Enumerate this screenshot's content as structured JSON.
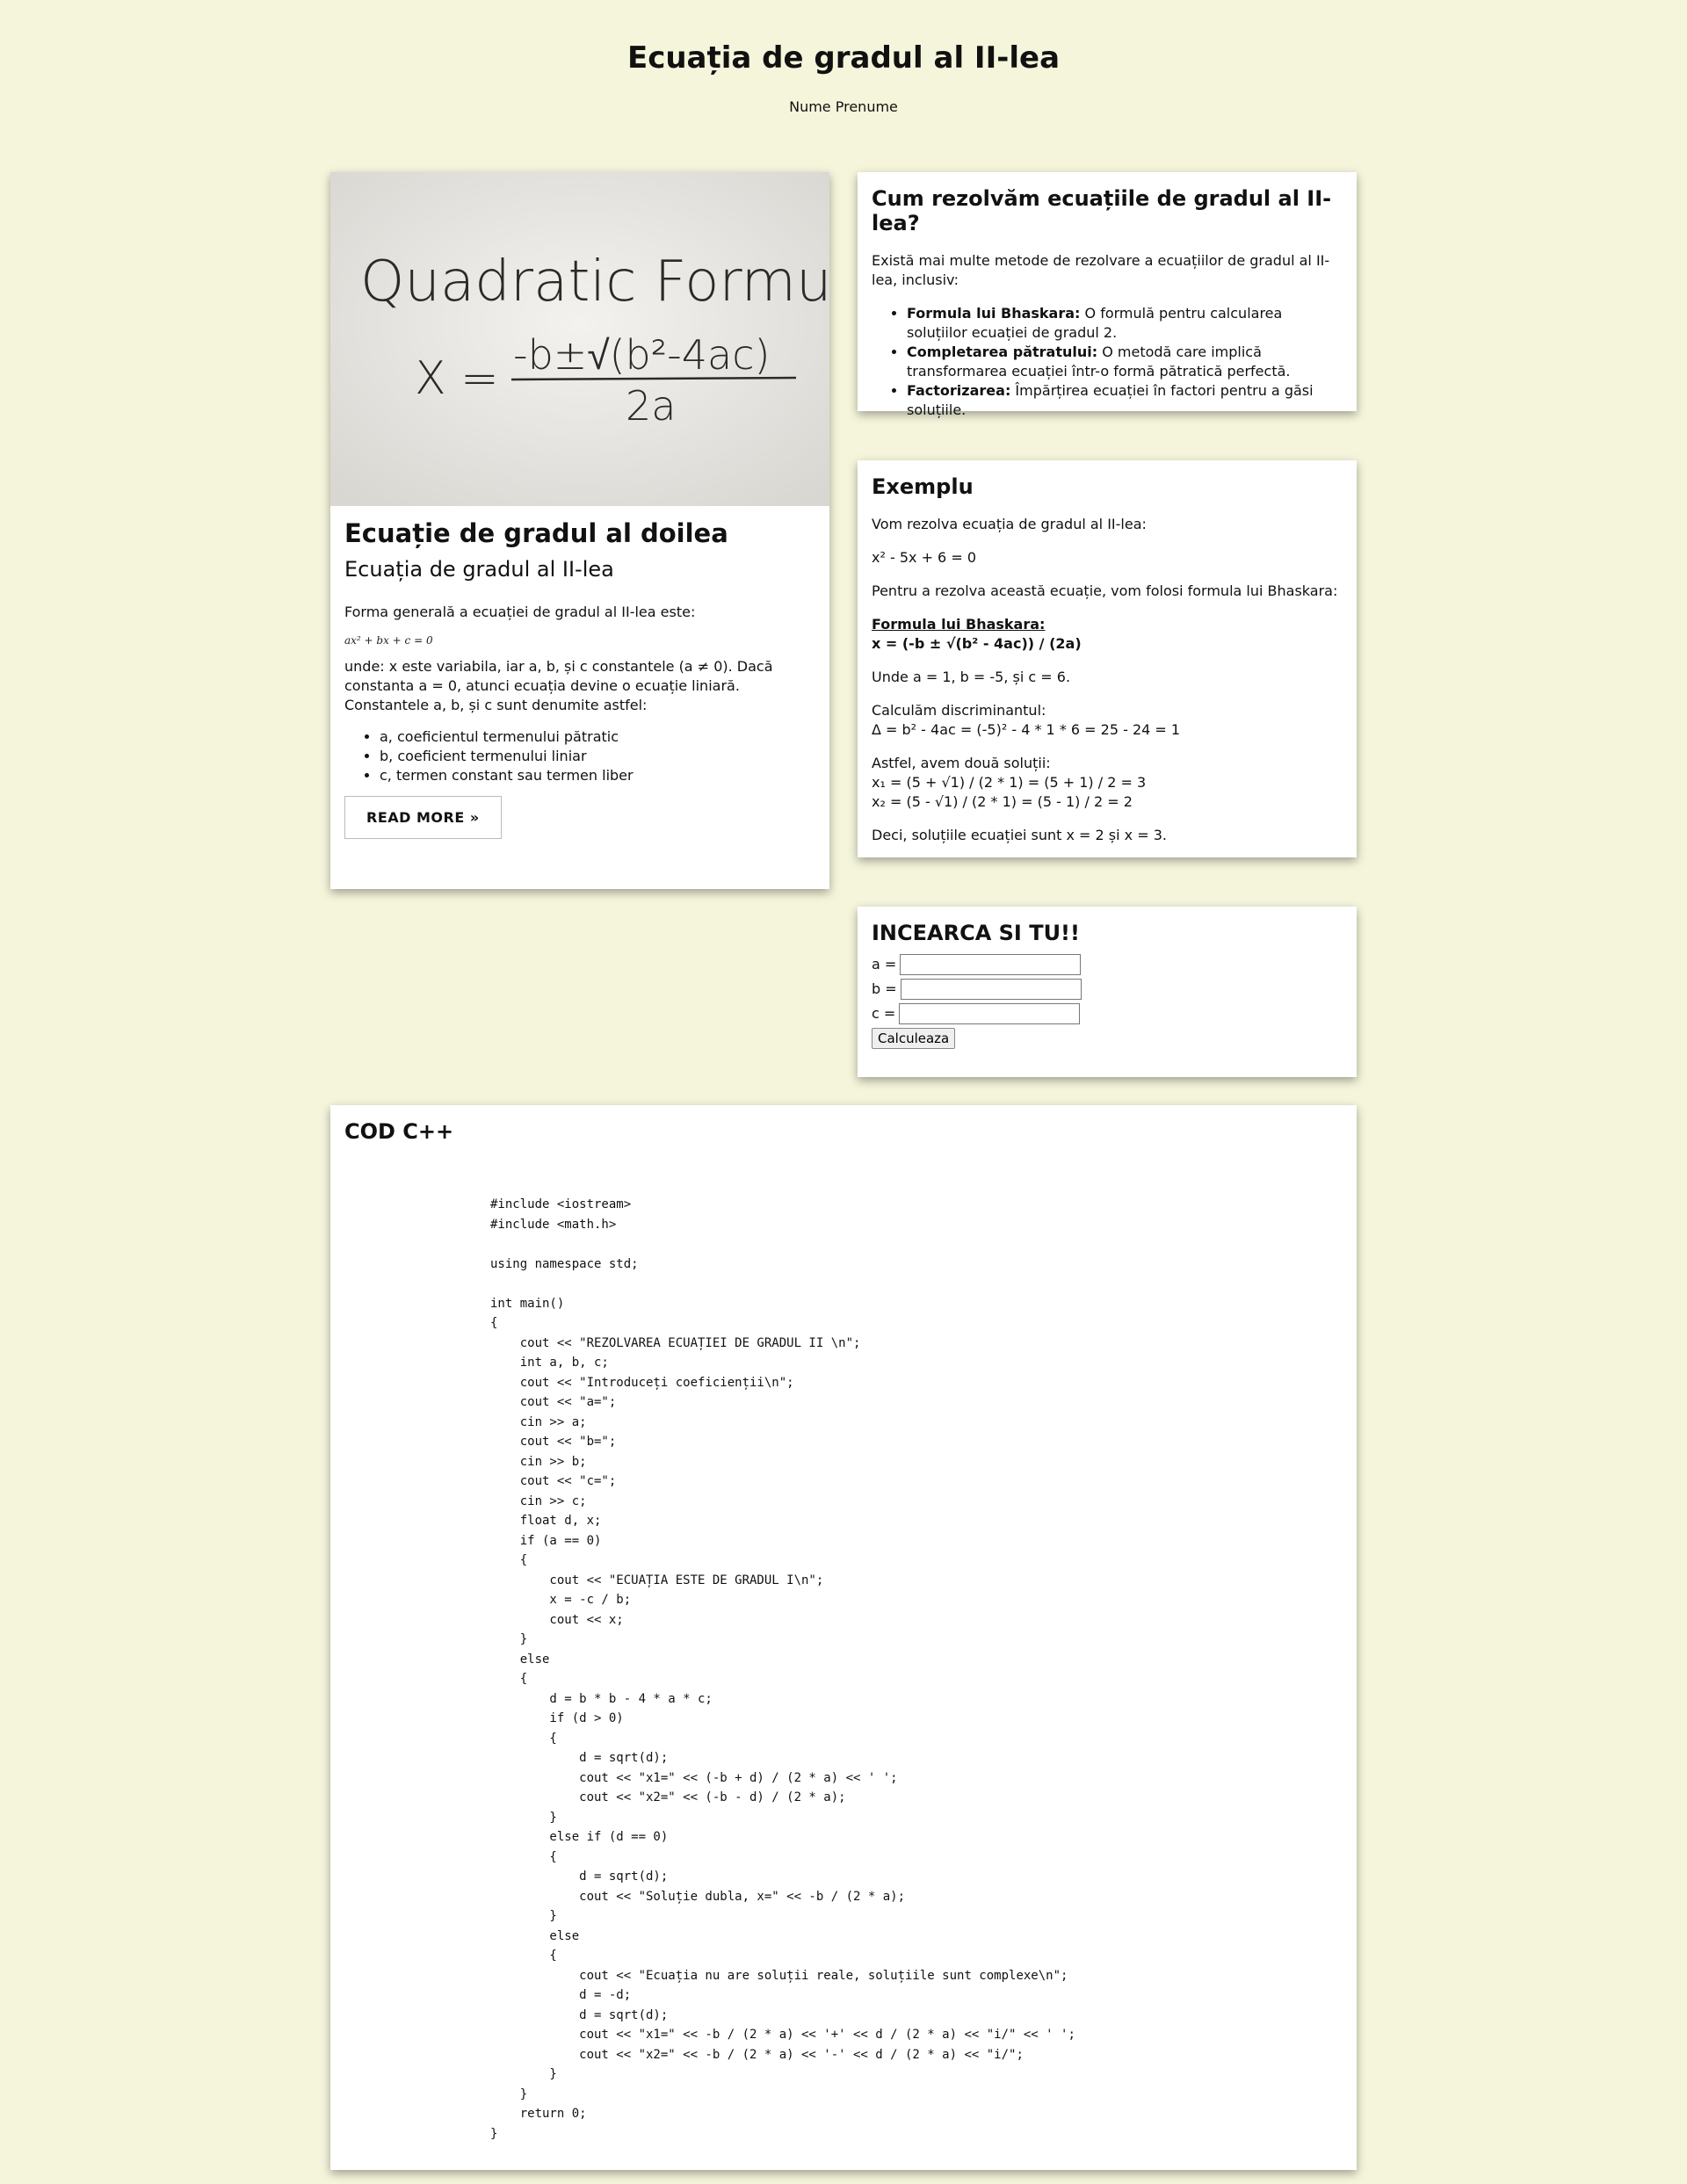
{
  "header": {
    "title": "Ecuația de gradul al II-lea",
    "author": "Nume Prenume"
  },
  "article": {
    "image_text": {
      "line1": "Quadratic Formula",
      "lhs": "X =",
      "numerator": "-b±√(b²-4ac)",
      "denominator": "2a"
    },
    "heading": "Ecuație de gradul al doilea",
    "subheading": "Ecuația de gradul al II-lea",
    "intro": "Forma generală a ecuației de gradul al II-lea este:",
    "formula": "ax² + bx + c = 0",
    "explanation": "unde: x este variabila, iar a, b, și c constantele (a ≠ 0). Dacă constanta a = 0, atunci ecuația devine o ecuație liniară. Constantele a, b, și c sunt denumite astfel:",
    "list": [
      "a, coeficientul termenului pătratic",
      "b, coeficient termenului liniar",
      "c, termen constant sau termen liber"
    ],
    "read_more": "READ MORE »"
  },
  "methods": {
    "title": "Cum rezolvăm ecuațiile de gradul al II-lea?",
    "intro": "Există mai multe metode de rezolvare a ecuațiilor de gradul al II-lea, inclusiv:",
    "items": [
      {
        "term": "Formula lui Bhaskara:",
        "desc": " O formulă pentru calcularea soluțiilor ecuației de gradul 2."
      },
      {
        "term": "Completarea pătratului:",
        "desc": " O metodă care implică transformarea ecuației într-o formă pătratică perfectă."
      },
      {
        "term": "Factorizarea:",
        "desc": " Împărțirea ecuației în factori pentru a găsi soluțiile."
      }
    ]
  },
  "example": {
    "title": "Exemplu",
    "line1": "Vom rezolva ecuația de gradul al II-lea:",
    "equation": "x² - 5x + 6 = 0",
    "line2": "Pentru a rezolva această ecuație, vom folosi formula lui Bhaskara:",
    "formula_label": "Formula lui Bhaskara:",
    "formula": "x = (-b ± √(b² - 4ac)) / (2a)",
    "coefs": "Unde a = 1, b = -5, și c = 6.",
    "disc_label": "Calculăm discriminantul:",
    "disc": "Δ = b² - 4ac = (-5)² - 4 * 1 * 6 = 25 - 24 = 1",
    "sol_label": "Astfel, avem două soluții:",
    "x1": "x₁ = (5 + √1) / (2 * 1) = (5 + 1) / 2 = 3",
    "x2": "x₂ = (5 - √1) / (2 * 1) = (5 - 1) / 2 = 2",
    "conclusion": "Deci, soluțiile ecuației sunt x = 2 și x = 3."
  },
  "try": {
    "title": "INCEARCA SI TU!!",
    "label_a": "a =",
    "label_b": "b =",
    "label_c": "c =",
    "value_a": "",
    "value_b": "",
    "value_c": "",
    "button": "Calculeaza"
  },
  "code": {
    "title": "COD C++",
    "source": "#include <iostream>\n#include <math.h>\n\nusing namespace std;\n\nint main()\n{\n    cout << \"REZOLVAREA ECUAȚIEI DE GRADUL II \\n\";\n    int a, b, c;\n    cout << \"Introduceți coeficienții\\n\";\n    cout << \"a=\";\n    cin >> a;\n    cout << \"b=\";\n    cin >> b;\n    cout << \"c=\";\n    cin >> c;\n    float d, x;\n    if (a == 0)\n    {\n        cout << \"ECUAȚIA ESTE DE GRADUL I\\n\";\n        x = -c / b;\n        cout << x;\n    }\n    else\n    {\n        d = b * b - 4 * a * c;\n        if (d > 0)\n        {\n            d = sqrt(d);\n            cout << \"x1=\" << (-b + d) / (2 * a) << ' ';\n            cout << \"x2=\" << (-b - d) / (2 * a);\n        }\n        else if (d == 0)\n        {\n            d = sqrt(d);\n            cout << \"Soluție dubla, x=\" << -b / (2 * a);\n        }\n        else\n        {\n            cout << \"Ecuația nu are soluții reale, soluțiile sunt complexe\\n\";\n            d = -d;\n            d = sqrt(d);\n            cout << \"x1=\" << -b / (2 * a) << '+' << d / (2 * a) << \"i/\" << ' ';\n            cout << \"x2=\" << -b / (2 * a) << '-' << d / (2 * a) << \"i/\";\n        }\n    }\n    return 0;\n}"
  }
}
